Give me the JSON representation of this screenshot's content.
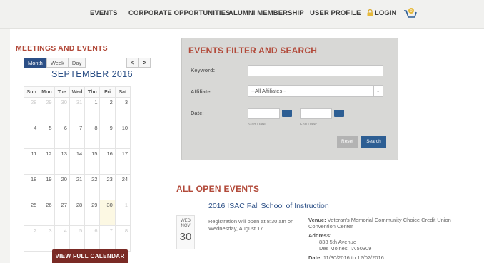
{
  "nav": {
    "items": [
      "EVENTS",
      "CORPORATE OPPORTUNITIES",
      "ALUMNI MEMBERSHIP",
      "USER PROFILE"
    ],
    "login": "LOGIN",
    "login_icon": "lock-icon",
    "cart_icon": "cart-icon",
    "cart_count": "0"
  },
  "calendar": {
    "section_title": "MEETINGS AND EVENTS",
    "views": [
      "Month",
      "Week",
      "Day"
    ],
    "active_view": "Month",
    "prev": "<",
    "next": ">",
    "month_title": "SEPTEMBER 2016",
    "weekdays": [
      "Sun",
      "Mon",
      "Tue",
      "Wed",
      "Thu",
      "Fri",
      "Sat"
    ],
    "weeks": [
      [
        "28",
        "29",
        "30",
        "31",
        "1",
        "2",
        "3"
      ],
      [
        "4",
        "5",
        "6",
        "7",
        "8",
        "9",
        "10"
      ],
      [
        "11",
        "12",
        "13",
        "14",
        "15",
        "16",
        "17"
      ],
      [
        "18",
        "19",
        "20",
        "21",
        "22",
        "23",
        "24"
      ],
      [
        "25",
        "26",
        "27",
        "28",
        "29",
        "30",
        "1"
      ],
      [
        "2",
        "3",
        "4",
        "5",
        "6",
        "7",
        "8"
      ]
    ],
    "view_full": "VIEW FULL CALENDAR"
  },
  "filter": {
    "title": "EVENTS FILTER AND SEARCH",
    "keyword_label": "Keyword:",
    "keyword_value": "",
    "affiliate_label": "Affiliate:",
    "affiliate_value": "--All Affiliates--",
    "date_label": "Date:",
    "start_date_label": "Start Date:",
    "end_date_label": "End Date:",
    "reset": "Reset",
    "search": "Search"
  },
  "events": {
    "title": "ALL OPEN EVENTS",
    "items": [
      {
        "name": "2016 ISAC Fall School of Instruction",
        "dow": "WED",
        "month": "NOV",
        "day": "30",
        "description": "Registration will open at 8:30 am on Wednesday, August 17.",
        "venue_label": "Venue:",
        "venue": "Veteran's Memorial Community Choice Credit Union Convention Center",
        "address_label": "Address:",
        "address_line1": "833 5th Avenue",
        "address_line2": "Des Moines, IA 50309",
        "date_label": "Date:",
        "date": "11/30/2016 to 12/02/2016"
      }
    ]
  },
  "colors": {
    "accent_red": "#b24a3a",
    "brand_blue": "#2b4f86",
    "button_dark_red": "#7a2a25"
  }
}
